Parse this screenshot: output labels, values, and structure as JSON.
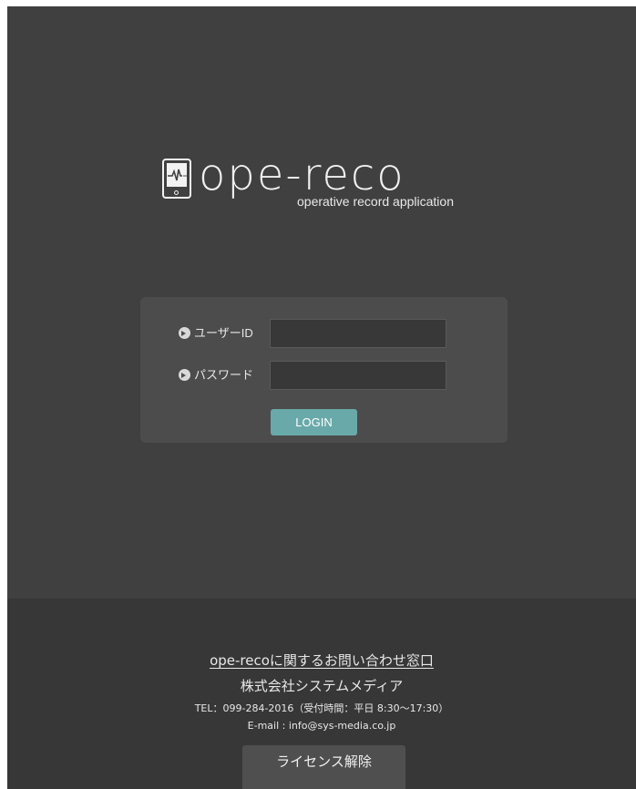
{
  "app": {
    "logo_wordmark": "ope-reco",
    "logo_tagline": "operative record application",
    "logo_icon": "tablet-heartbeat-icon"
  },
  "login": {
    "user_id_label": "ユーザーID",
    "user_id_value": "",
    "password_label": "パスワード",
    "password_value": "",
    "bullet_icon": "circle-arrow-right-icon",
    "login_button": "LOGIN",
    "button_color": "#69a9a9"
  },
  "footer": {
    "contact_title": "ope-recoに関するお問い合わせ窓口",
    "company_name": "株式会社システムメディア",
    "tel": "TEL：099-284-2016（受付時間：平日 8:30〜17:30）",
    "email": "E-mail : info@sys-media.co.jp",
    "license_button": "ライセンス解除"
  },
  "colors": {
    "background": "#404040",
    "panel": "#4c4c4c",
    "footer": "#373737"
  }
}
